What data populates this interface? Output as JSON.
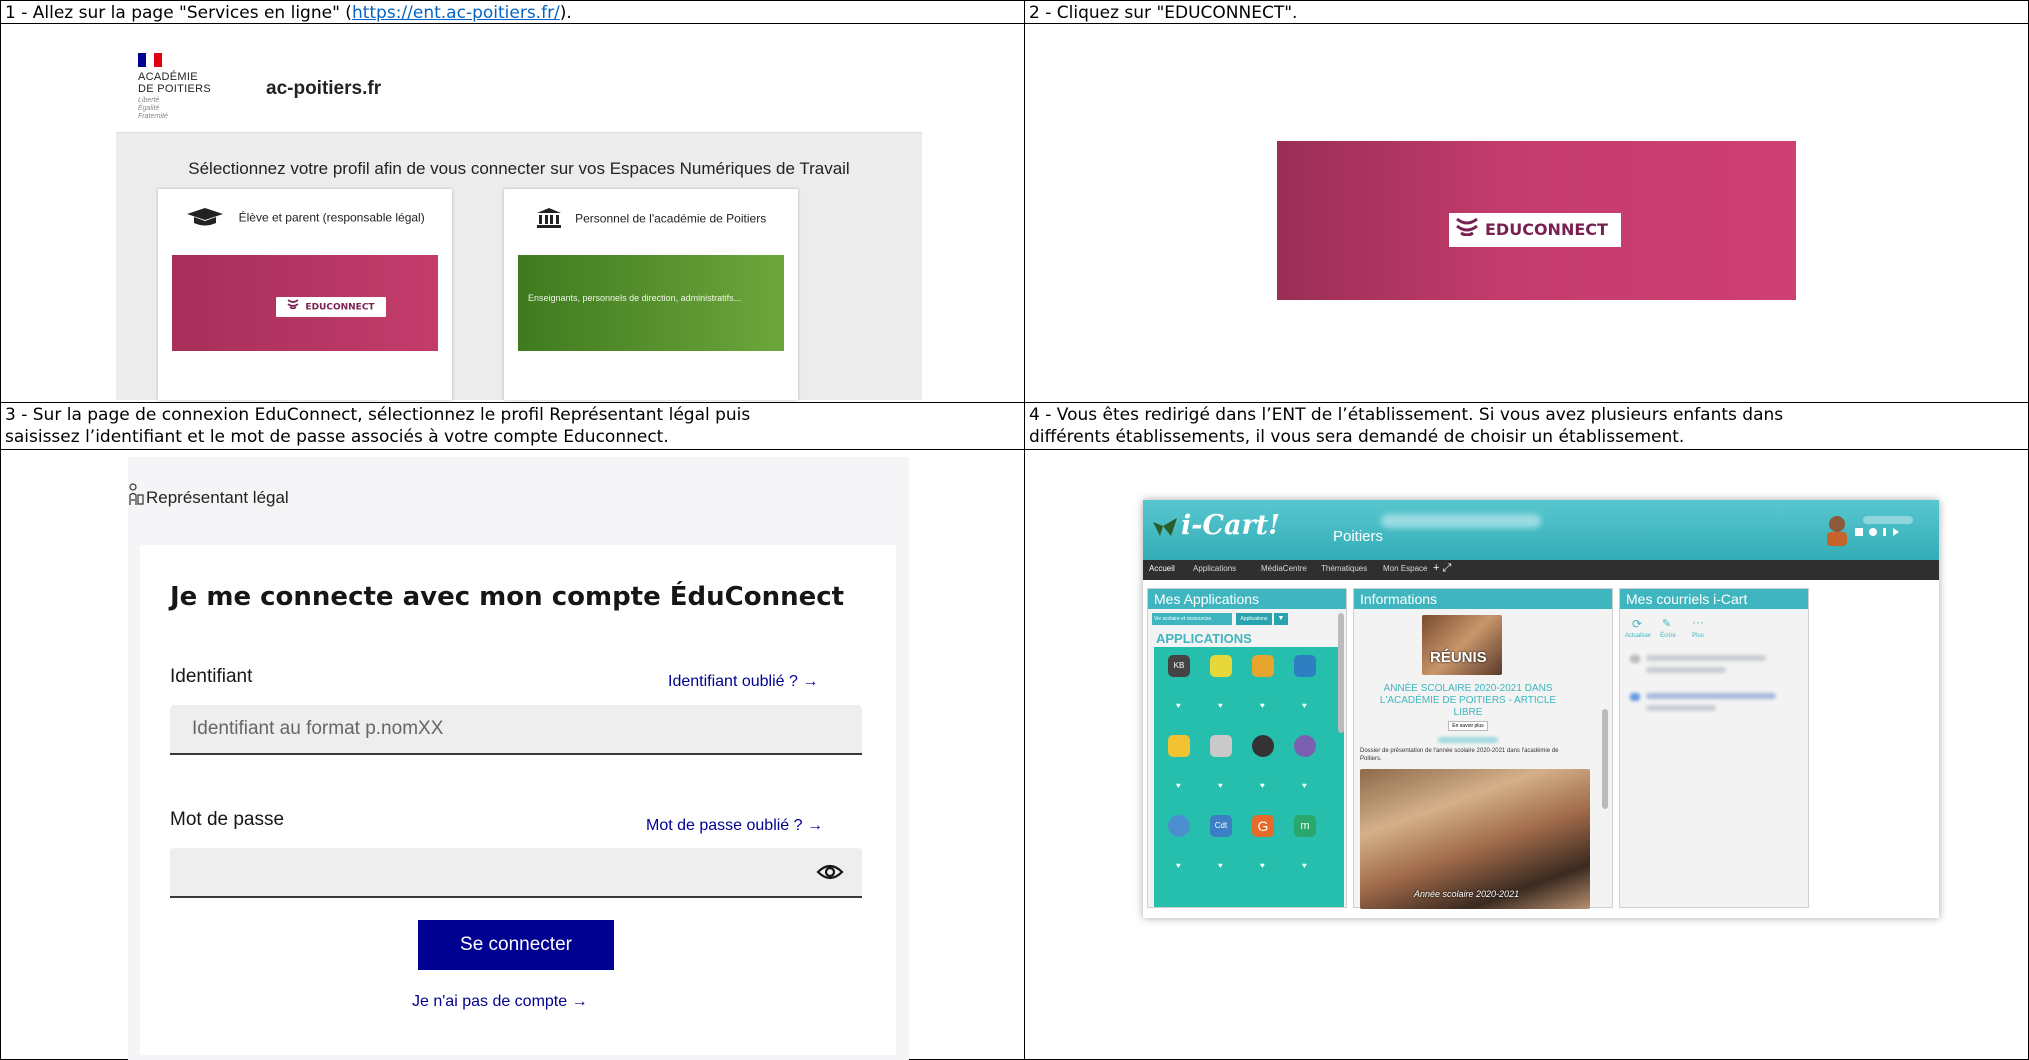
{
  "steps": [
    {
      "prefix": "1 - Allez sur la page \"Services en ligne\" (",
      "link": "https://ent.ac-poitiers.fr/",
      "suffix": ")."
    },
    {
      "text": "2 - Cliquez sur \"EDUCONNECT\"."
    },
    {
      "line1": "3 - Sur la page de connexion EduConnect, sélectionnez le profil Représentant légal puis",
      "line2": "saisissez l’identifiant et le mot de passe associés à votre compte Educonnect."
    },
    {
      "line1": "4 - Vous êtes redirigé dans l’ENT de l’établissement. Si vous avez plusieurs enfants dans",
      "line2": "différents établissements, il vous sera demandé de choisir un établissement."
    }
  ],
  "panel1": {
    "academy_line1": "ACADÉMIE",
    "academy_line2": "DE POITIERS",
    "motto": "Liberté Égalité Fraternité",
    "domain": "ac-poitiers.fr",
    "title": "Sélectionnez votre profil afin de vous connecter sur vos Espaces Numériques de Travail",
    "card_student": "Élève et parent (responsable légal)",
    "card_staff": "Personnel de l'académie de Poitiers",
    "educonnect_small": "EDUCONNECT",
    "staff_band_text": "Enseignants, personnels de direction, administratifs..."
  },
  "panel2": {
    "educonnect_button": "EDUCONNECT"
  },
  "panel3": {
    "profile": "Représentant légal",
    "form_title": "Je me connecte avec mon compte ÉduConnect",
    "id_label": "Identifiant",
    "id_forgot": "Identifiant oublié ? →",
    "id_placeholder": "Identifiant au format p.nomXX",
    "pw_label": "Mot de passe",
    "pw_forgot": "Mot de passe oublié ? →",
    "submit": "Se connecter",
    "no_account": "Je n'ai pas de compte →"
  },
  "panel4": {
    "logo": "i-Cart!",
    "city": "Poitiers",
    "nav": [
      "Accueil",
      "Applications",
      "MédiaCentre",
      "Thématiques",
      "Mon Espace"
    ],
    "col_apps": "Mes Applications",
    "col_info": "Informations",
    "col_mail": "Mes courriels i-Cart",
    "apps_filter": "Vie scolaire et ressources",
    "apps_btn": "Applications",
    "apps_heading": "APPLICATIONS",
    "app_tile_labels": [
      "KB",
      "Cdt",
      "G",
      "m"
    ],
    "info_overlay": "RÉUNIS",
    "info_title": "ANNÉE SCOLAIRE 2020-2021 DANS L'ACADÉMIE DE POITIERS - ARTICLE LIBRE",
    "info_more": "En savoir plus",
    "info_desc": "Dossier de présentation de l'année scolaire 2020-2021 dans l'académie de Poitiers.",
    "info_photo_caption": "Année scolaire 2020-2021",
    "mail_actions": [
      "Actualiser",
      "Écrire",
      "Plus"
    ]
  },
  "colors": {
    "educonnect_pink": "#c33c6b",
    "staff_green": "#5a9a30",
    "dsfr_blue": "#000091",
    "ent_teal": "#3fb6bf",
    "link_blue": "#0563c1"
  }
}
